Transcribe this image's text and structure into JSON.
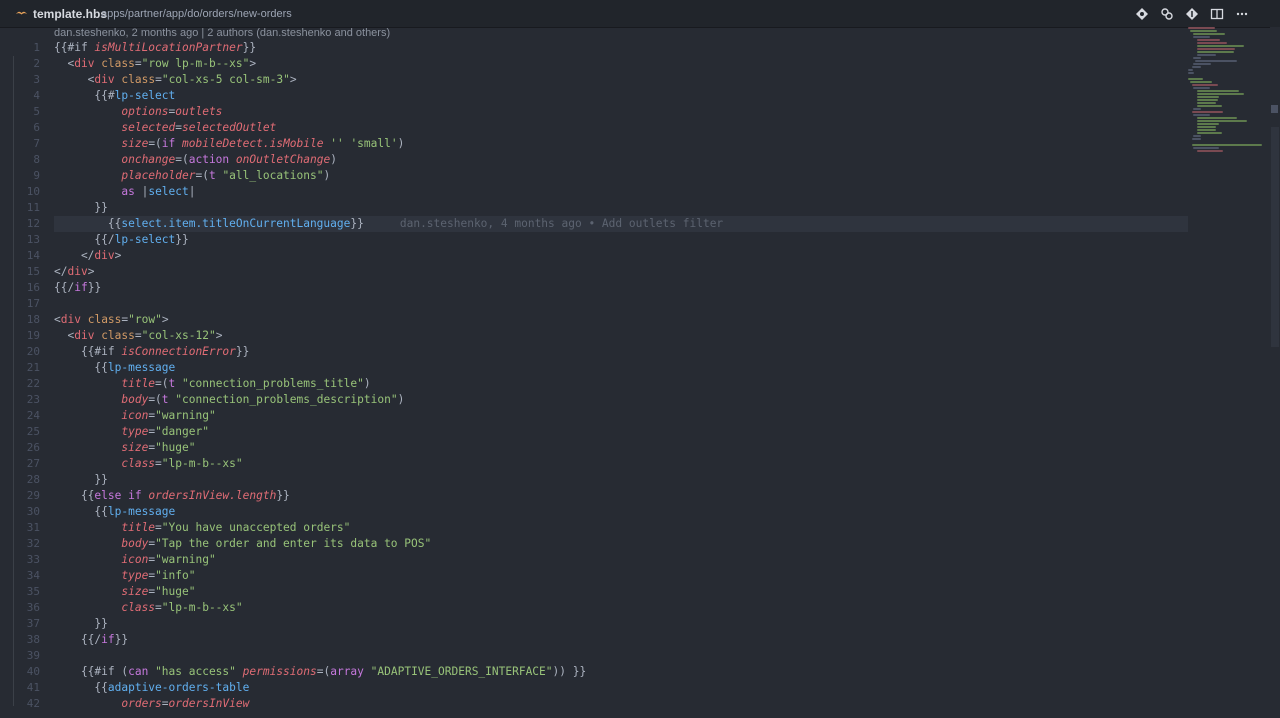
{
  "tab": {
    "title": "template.hbs",
    "path": "apps/partner/app/do/orders/new-orders"
  },
  "icons": {
    "file": "handlebars-file-icon",
    "actions": [
      "git-commit-icon",
      "open-changes-icon",
      "git-compare-icon",
      "split-editor-icon",
      "more-actions-icon"
    ]
  },
  "codelens": "dan.steshenko, 2 months ago | 2 authors (dan.steshenko and others)",
  "current_line": 12,
  "blame_annotation": "dan.steshenko, 4 months ago • Add outlets filter",
  "colors": {
    "background": "#272b33",
    "tag": "#e06c75",
    "attribute": "#d19a66",
    "string": "#98c379",
    "keyword": "#c678dd",
    "function": "#61afef"
  },
  "lines": [
    [
      [
        "p",
        "{{#if "
      ],
      [
        "it",
        "isMultiLocationPartner"
      ],
      [
        "p",
        "}}"
      ]
    ],
    [
      [
        "p",
        "  <"
      ],
      [
        "tag",
        "div"
      ],
      [
        "p",
        " "
      ],
      [
        "attr",
        "class"
      ],
      [
        "p",
        "="
      ],
      [
        "str",
        "\"row lp-m-b--xs\""
      ],
      [
        "p",
        ">"
      ]
    ],
    [
      [
        "p",
        "     <"
      ],
      [
        "tag",
        "div"
      ],
      [
        "p",
        " "
      ],
      [
        "attr",
        "class"
      ],
      [
        "p",
        "="
      ],
      [
        "str",
        "\"col-xs-5 col-sm-3\""
      ],
      [
        "p",
        ">"
      ]
    ],
    [
      [
        "p",
        "      {{#"
      ],
      [
        "fn",
        "lp-select"
      ]
    ],
    [
      [
        "p",
        "          "
      ],
      [
        "it",
        "options"
      ],
      [
        "p",
        "="
      ],
      [
        "it",
        "outlets"
      ]
    ],
    [
      [
        "p",
        "          "
      ],
      [
        "it",
        "selected"
      ],
      [
        "p",
        "="
      ],
      [
        "it",
        "selectedOutlet"
      ]
    ],
    [
      [
        "p",
        "          "
      ],
      [
        "it",
        "size"
      ],
      [
        "p",
        "=("
      ],
      [
        "kw",
        "if"
      ],
      [
        "p",
        " "
      ],
      [
        "it",
        "mobileDetect.isMobile"
      ],
      [
        "p",
        " "
      ],
      [
        "str",
        "'' 'small'"
      ],
      [
        "p",
        ")"
      ]
    ],
    [
      [
        "p",
        "          "
      ],
      [
        "it",
        "onchange"
      ],
      [
        "p",
        "=("
      ],
      [
        "kw",
        "action"
      ],
      [
        "p",
        " "
      ],
      [
        "it",
        "onOutletChange"
      ],
      [
        "p",
        ")"
      ]
    ],
    [
      [
        "p",
        "          "
      ],
      [
        "it",
        "placeholder"
      ],
      [
        "p",
        "=("
      ],
      [
        "kw",
        "t"
      ],
      [
        "p",
        " "
      ],
      [
        "str",
        "\"all_locations\""
      ],
      [
        "p",
        ")"
      ]
    ],
    [
      [
        "p",
        "          "
      ],
      [
        "kw",
        "as"
      ],
      [
        "p",
        " |"
      ],
      [
        "fn",
        "select"
      ],
      [
        "p",
        "|"
      ]
    ],
    [
      [
        "p",
        "      }}"
      ]
    ],
    [
      [
        "p",
        "        {{"
      ],
      [
        "fn",
        "select.item.titleOnCurrentLanguage"
      ],
      [
        "p",
        "}}"
      ]
    ],
    [
      [
        "p",
        "      {{/"
      ],
      [
        "fn",
        "lp-select"
      ],
      [
        "p",
        "}}"
      ]
    ],
    [
      [
        "p",
        "    </"
      ],
      [
        "tag",
        "div"
      ],
      [
        "p",
        ">"
      ]
    ],
    [
      [
        "p",
        "</"
      ],
      [
        "tag",
        "div"
      ],
      [
        "p",
        ">"
      ]
    ],
    [
      [
        "p",
        "{{/"
      ],
      [
        "kw",
        "if"
      ],
      [
        "p",
        "}}"
      ]
    ],
    [],
    [
      [
        "p",
        "<"
      ],
      [
        "tag",
        "div"
      ],
      [
        "p",
        " "
      ],
      [
        "attr",
        "class"
      ],
      [
        "p",
        "="
      ],
      [
        "str",
        "\"row\""
      ],
      [
        "p",
        ">"
      ]
    ],
    [
      [
        "p",
        "  <"
      ],
      [
        "tag",
        "div"
      ],
      [
        "p",
        " "
      ],
      [
        "attr",
        "class"
      ],
      [
        "p",
        "="
      ],
      [
        "str",
        "\"col-xs-12\""
      ],
      [
        "p",
        ">"
      ]
    ],
    [
      [
        "p",
        "    {{#if "
      ],
      [
        "it",
        "isConnectionError"
      ],
      [
        "p",
        "}}"
      ]
    ],
    [
      [
        "p",
        "      {{"
      ],
      [
        "fn",
        "lp-message"
      ]
    ],
    [
      [
        "p",
        "          "
      ],
      [
        "it",
        "title"
      ],
      [
        "p",
        "=("
      ],
      [
        "kw",
        "t"
      ],
      [
        "p",
        " "
      ],
      [
        "str",
        "\"connection_problems_title\""
      ],
      [
        "p",
        ")"
      ]
    ],
    [
      [
        "p",
        "          "
      ],
      [
        "it",
        "body"
      ],
      [
        "p",
        "=("
      ],
      [
        "kw",
        "t"
      ],
      [
        "p",
        " "
      ],
      [
        "str",
        "\"connection_problems_description\""
      ],
      [
        "p",
        ")"
      ]
    ],
    [
      [
        "p",
        "          "
      ],
      [
        "it",
        "icon"
      ],
      [
        "p",
        "="
      ],
      [
        "str",
        "\"warning\""
      ]
    ],
    [
      [
        "p",
        "          "
      ],
      [
        "it",
        "type"
      ],
      [
        "p",
        "="
      ],
      [
        "str",
        "\"danger\""
      ]
    ],
    [
      [
        "p",
        "          "
      ],
      [
        "it",
        "size"
      ],
      [
        "p",
        "="
      ],
      [
        "str",
        "\"huge\""
      ]
    ],
    [
      [
        "p",
        "          "
      ],
      [
        "it",
        "class"
      ],
      [
        "p",
        "="
      ],
      [
        "str",
        "\"lp-m-b--xs\""
      ]
    ],
    [
      [
        "p",
        "      }}"
      ]
    ],
    [
      [
        "p",
        "    {{"
      ],
      [
        "kw",
        "else if"
      ],
      [
        "p",
        " "
      ],
      [
        "it",
        "ordersInView.length"
      ],
      [
        "p",
        "}}"
      ]
    ],
    [
      [
        "p",
        "      {{"
      ],
      [
        "fn",
        "lp-message"
      ]
    ],
    [
      [
        "p",
        "          "
      ],
      [
        "it",
        "title"
      ],
      [
        "p",
        "="
      ],
      [
        "str",
        "\"You have unaccepted orders\""
      ]
    ],
    [
      [
        "p",
        "          "
      ],
      [
        "it",
        "body"
      ],
      [
        "p",
        "="
      ],
      [
        "str",
        "\"Tap the order and enter its data to POS\""
      ]
    ],
    [
      [
        "p",
        "          "
      ],
      [
        "it",
        "icon"
      ],
      [
        "p",
        "="
      ],
      [
        "str",
        "\"warning\""
      ]
    ],
    [
      [
        "p",
        "          "
      ],
      [
        "it",
        "type"
      ],
      [
        "p",
        "="
      ],
      [
        "str",
        "\"info\""
      ]
    ],
    [
      [
        "p",
        "          "
      ],
      [
        "it",
        "size"
      ],
      [
        "p",
        "="
      ],
      [
        "str",
        "\"huge\""
      ]
    ],
    [
      [
        "p",
        "          "
      ],
      [
        "it",
        "class"
      ],
      [
        "p",
        "="
      ],
      [
        "str",
        "\"lp-m-b--xs\""
      ]
    ],
    [
      [
        "p",
        "      }}"
      ]
    ],
    [
      [
        "p",
        "    {{/"
      ],
      [
        "kw",
        "if"
      ],
      [
        "p",
        "}}"
      ]
    ],
    [],
    [
      [
        "p",
        "    {{#if ("
      ],
      [
        "kw",
        "can"
      ],
      [
        "p",
        " "
      ],
      [
        "str",
        "\"has access\""
      ],
      [
        "p",
        " "
      ],
      [
        "it",
        "permissions"
      ],
      [
        "p",
        "=("
      ],
      [
        "kw",
        "array"
      ],
      [
        "p",
        " "
      ],
      [
        "str",
        "\"ADAPTIVE_ORDERS_INTERFACE\""
      ],
      [
        "p",
        ")) }}"
      ]
    ],
    [
      [
        "p",
        "      {{"
      ],
      [
        "fn",
        "adaptive-orders-table"
      ]
    ],
    [
      [
        "p",
        "          "
      ],
      [
        "it",
        "orders"
      ],
      [
        "p",
        "="
      ],
      [
        "it",
        "ordersInView"
      ]
    ]
  ]
}
